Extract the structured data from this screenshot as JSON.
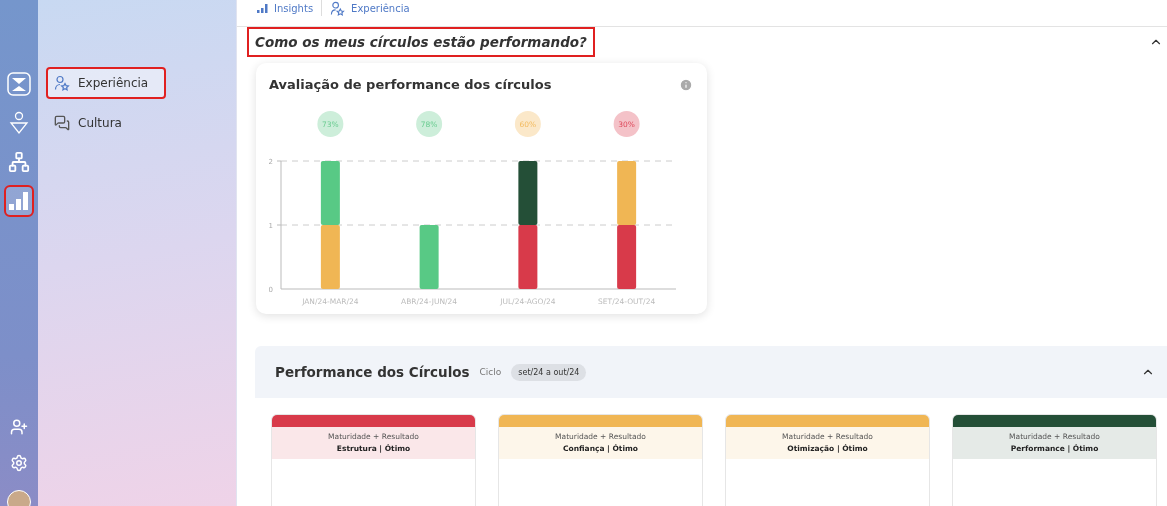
{
  "rail": {
    "items": [
      {
        "kind": "logo",
        "selected": false,
        "highlighted": false
      },
      {
        "kind": "ai-user",
        "selected": false,
        "highlighted": false
      },
      {
        "kind": "network",
        "selected": false,
        "highlighted": false
      },
      {
        "kind": "chart",
        "selected": true,
        "highlighted": true
      }
    ],
    "bottom": [
      {
        "kind": "add-user"
      },
      {
        "kind": "settings"
      },
      {
        "kind": "avatar"
      }
    ]
  },
  "sidebar": {
    "items": [
      {
        "label": "Experiência",
        "kind": "user-star",
        "selected": true,
        "highlighted": true
      },
      {
        "label": "Cultura",
        "kind": "chat",
        "selected": false,
        "highlighted": false
      }
    ]
  },
  "breadcrumb": [
    {
      "label": "Insights",
      "kind": "chart"
    },
    {
      "label": "Experiência",
      "kind": "user-star"
    }
  ],
  "section": {
    "title": "Como os meus círculos estão performando?",
    "highlighted": true,
    "expanded": true
  },
  "chart_card": {
    "title": "Avaliação de performance dos círculos",
    "chart_data": {
      "type": "bar",
      "stacked": true,
      "categories": [
        "JAN/24-MAR/24",
        "ABR/24-JUN/24",
        "JUL/24-AGO/24",
        "SET/24-OUT/24"
      ],
      "series": [
        {
          "color": "#d83a4a",
          "values": [
            0,
            0,
            1,
            1
          ]
        },
        {
          "color": "#f0b654",
          "values": [
            1,
            0,
            0,
            1
          ]
        },
        {
          "color": "#58c985",
          "values": [
            1,
            1,
            0,
            0
          ]
        },
        {
          "color": "#244f37",
          "values": [
            0,
            0,
            1,
            0
          ]
        }
      ],
      "ylim": [
        0,
        2
      ],
      "yticks": [
        0,
        1,
        2
      ]
    },
    "badges": [
      {
        "label": "73%",
        "color": "#cdeeda"
      },
      {
        "label": "78%",
        "color": "#cdeeda"
      },
      {
        "label": "60%",
        "color": "#fbe8c9"
      },
      {
        "label": "30%",
        "color": "#f4c2c8"
      }
    ]
  },
  "performance": {
    "title": "Performance dos Círculos",
    "cycle_label": "Ciclo",
    "cycle": "set/24 a out/24",
    "expanded": true,
    "cards": [
      {
        "subtitle": "Maturidade + Resultado",
        "title": "Estrutura | Ótimo",
        "color": "#d83a4a"
      },
      {
        "subtitle": "Maturidade + Resultado",
        "title": "Confiança | Ótimo",
        "color": "#f0b654"
      },
      {
        "subtitle": "Maturidade + Resultado",
        "title": "Otimização | Ótimo",
        "color": "#f0b654"
      },
      {
        "subtitle": "Maturidade + Resultado",
        "title": "Performance | Ótimo",
        "color": "#244f37"
      }
    ]
  }
}
